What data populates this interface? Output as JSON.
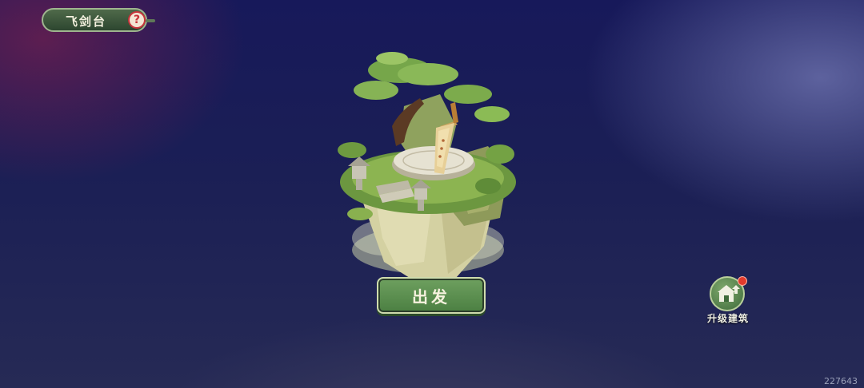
{
  "header": {
    "title": "飞剑台",
    "help_icon": "question-mark-icon",
    "help_glyph": "?"
  },
  "scene": {
    "building": "floating-island-sword-altar"
  },
  "actions": {
    "depart_label": "出发"
  },
  "upgrade": {
    "label": "升级建筑",
    "icon": "building-upgrade-icon",
    "has_notification": true
  },
  "footer": {
    "uid": "227643"
  },
  "colors": {
    "button_green": "#5e9150",
    "button_border": "#cfdcae",
    "help_red": "#c8333a",
    "notification_red": "#e23a2c"
  }
}
